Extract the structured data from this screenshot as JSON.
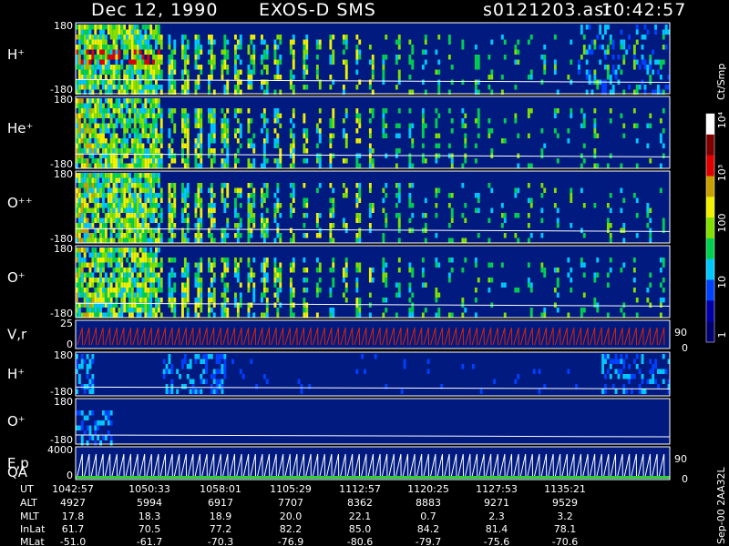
{
  "header": {
    "date": "Dec 12, 1990",
    "instrument": "EXOS-D SMS",
    "file": "s0121203.asr",
    "time": "10:42:57"
  },
  "colorbar": {
    "unit": "Ct/Smp",
    "ticks": [
      "1",
      "10",
      "100",
      "10³",
      "10⁴"
    ],
    "colors": [
      "#000070",
      "#0000a8",
      "#0040ff",
      "#00c8ff",
      "#00d050",
      "#80e000",
      "#f0f000",
      "#c8a000",
      "#e00000",
      "#800000",
      "#ffffff"
    ]
  },
  "footer_note": "Sep-00 2AA32L",
  "panels": [
    {
      "label": "H⁺",
      "top": "180",
      "bottom": "-180",
      "activity": "early-dense-bursty-late"
    },
    {
      "label": "He⁺",
      "top": "180",
      "bottom": "-180",
      "activity": "early-dense-bursty"
    },
    {
      "label": "O⁺⁺",
      "top": "180",
      "bottom": "-180",
      "activity": "early-dense-bursty"
    },
    {
      "label": "O⁺",
      "top": "180",
      "bottom": "-180",
      "activity": "early-dense-bursty"
    },
    {
      "label": "V,r",
      "top": "25",
      "bottom": "0",
      "right": [
        "90",
        "0"
      ],
      "activity": "sawtooth-red"
    },
    {
      "label": "H⁺",
      "top": "180",
      "bottom": "-180",
      "activity": "sparse-late"
    },
    {
      "label": "O⁺",
      "top": "180",
      "bottom": "-180",
      "activity": "sparse-early"
    },
    {
      "label": "E,p",
      "label2": "QA",
      "top": "4000",
      "bottom": "0",
      "right": [
        "90",
        "0"
      ],
      "activity": "sawtooth-white"
    }
  ],
  "table": {
    "row_labels": [
      "UT",
      "ALT",
      "MLT",
      "InLat",
      "MLat"
    ],
    "columns": [
      [
        "1042:57",
        "4927",
        "17.8",
        "61.7",
        "-51.0"
      ],
      [
        "1050:33",
        "5994",
        "18.3",
        "70.5",
        "-61.7"
      ],
      [
        "1058:01",
        "6917",
        "18.9",
        "77.2",
        "-70.3"
      ],
      [
        "1105:29",
        "7707",
        "20.0",
        "82.2",
        "-76.9"
      ],
      [
        "1112:57",
        "8362",
        "22.1",
        "85.0",
        "-80.6"
      ],
      [
        "1120:25",
        "8883",
        "0.7",
        "84.2",
        "-79.7"
      ],
      [
        "1127:53",
        "9271",
        "2.3",
        "81.4",
        "-75.6"
      ],
      [
        "1135:21",
        "9529",
        "3.2",
        "78.1",
        "-70.6"
      ]
    ]
  },
  "chart_data": {
    "type": "heatmap",
    "x_label": "UT",
    "x_ticks": [
      "1042:57",
      "1050:33",
      "1058:01",
      "1105:29",
      "1112:57",
      "1120:25",
      "1127:53",
      "1135:21"
    ],
    "series": [
      "H⁺",
      "He⁺",
      "O⁺⁺",
      "O⁺",
      "V,r",
      "H⁺",
      "O⁺",
      "E,p"
    ]
  }
}
